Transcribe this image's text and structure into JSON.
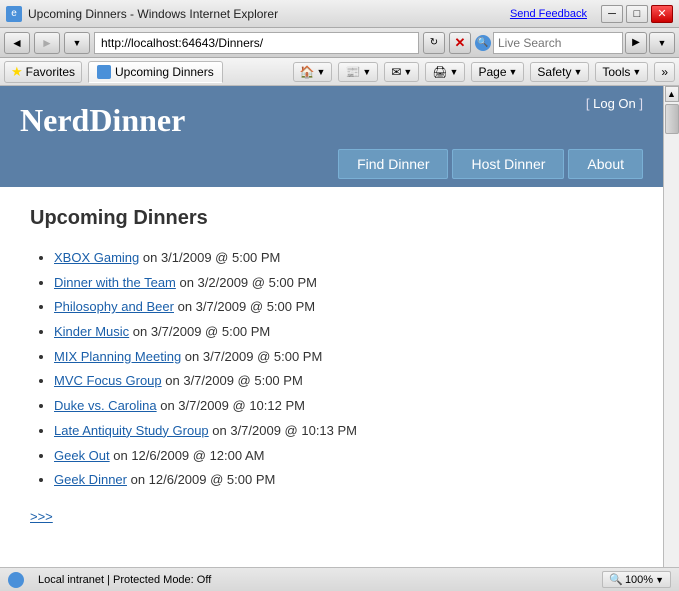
{
  "browser": {
    "title": "Upcoming Dinners - Windows Internet Explorer",
    "send_feedback": "Send Feedback",
    "address": "http://localhost:64643/Dinners/",
    "search_placeholder": "Live Search",
    "tab_label": "Upcoming Dinners",
    "nav": {
      "back": "◄",
      "forward": "►",
      "refresh": "↻",
      "stop": "✕"
    },
    "toolbar": {
      "favorites_btn": "Favorites",
      "page_btn": "Page",
      "safety_btn": "Safety",
      "tools_btn": "Tools"
    },
    "status": "Local intranet | Protected Mode: Off",
    "zoom": "100%"
  },
  "site": {
    "title": "NerdDinner",
    "log_on_prefix": "[ ",
    "log_on_label": "Log On",
    "log_on_suffix": " ]",
    "nav_items": [
      {
        "label": "Find Dinner",
        "href": "#"
      },
      {
        "label": "Host Dinner",
        "href": "#"
      },
      {
        "label": "About",
        "href": "#"
      }
    ]
  },
  "main": {
    "heading": "Upcoming Dinners",
    "dinners": [
      {
        "name": "XBOX Gaming",
        "detail": " on 3/1/2009 @ 5:00 PM"
      },
      {
        "name": "Dinner with the Team",
        "detail": " on 3/2/2009 @ 5:00 PM"
      },
      {
        "name": "Philosophy and Beer",
        "detail": " on 3/7/2009 @ 5:00 PM"
      },
      {
        "name": "Kinder Music",
        "detail": " on 3/7/2009 @ 5:00 PM"
      },
      {
        "name": "MIX Planning Meeting",
        "detail": " on 3/7/2009 @ 5:00 PM"
      },
      {
        "name": "MVC Focus Group",
        "detail": " on 3/7/2009 @ 5:00 PM"
      },
      {
        "name": "Duke vs. Carolina",
        "detail": " on 3/7/2009 @ 10:12 PM"
      },
      {
        "name": "Late Antiquity Study Group",
        "detail": " on 3/7/2009 @ 10:13 PM"
      },
      {
        "name": "Geek Out",
        "detail": " on 12/6/2009 @ 12:00 AM"
      },
      {
        "name": "Geek Dinner",
        "detail": " on 12/6/2009 @ 5:00 PM"
      }
    ],
    "more_link": ">>>"
  }
}
